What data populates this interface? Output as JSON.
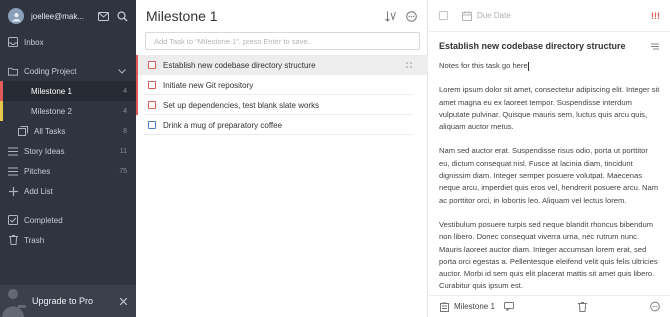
{
  "sidebar": {
    "user": "joellee@mak...",
    "items": {
      "inbox": {
        "label": "Inbox",
        "count": ""
      },
      "project": {
        "label": "Coding Project",
        "count": ""
      },
      "milestone1": {
        "label": "Milestone 1",
        "count": "4"
      },
      "milestone2": {
        "label": "Milestone 2",
        "count": "4"
      },
      "alltasks": {
        "label": "All Tasks",
        "count": "8"
      },
      "story": {
        "label": "Story Ideas",
        "count": "11"
      },
      "pitches": {
        "label": "Pitches",
        "count": "75"
      },
      "addlist": {
        "label": "Add List"
      },
      "completed": {
        "label": "Completed"
      },
      "trash": {
        "label": "Trash"
      }
    },
    "upgrade_label": "Upgrade to Pro"
  },
  "list": {
    "title": "Milestone 1",
    "add_placeholder": "Add Task to \"Milestone 1\", press Enter to save.",
    "tasks": [
      {
        "title": "Establish new codebase directory structure"
      },
      {
        "title": "Initiate new Git repository"
      },
      {
        "title": "Set up dependencies, test blank slate works"
      },
      {
        "title": "Drink a mug of preparatory coffee"
      }
    ]
  },
  "detail": {
    "due_placeholder": "Due Date",
    "priority_mark": "!!!",
    "title": "Establish new codebase directory structure",
    "note_first": "Notes for this task go here",
    "paragraphs": [
      "Lorem ipsum dolor sit amet, consectetur adipiscing elit. Integer sit amet magna eu ex laoreet tempor. Suspendisse interdum vulputate pulvinar. Quisque mauris sem, luctus quis arcu quis, aliquam auctor metus.",
      "Nam sed auctor erat. Suspendisse risus odio, porta ut porttitor eu, dictum consequat nisl. Fusce at lacinia diam, tincidunt dignissim diam. Integer semper posuere volutpat. Maecenas neque arcu, imperdiet quis eros vel, hendrerit posuere arcu. Nam ac porttitor orci, in lobortis leo. Aliquam vel lectus lorem.",
      "Vestibulum posuere turpis sed neque blandit rhoncus bibendum non libero. Donec consequat viverra urna, nec rutrum nunc. Mauris laoreet auctor diam. Integer accumsan lorem erat, sed porta orci egestas a. Pellentesque eleifend velit quis felis ultricies auctor. Morbi id sem quis elit placerat mattis sit amet quis libero. Curabitur quis ipsum est."
    ],
    "footer_list": "Milestone 1"
  }
}
